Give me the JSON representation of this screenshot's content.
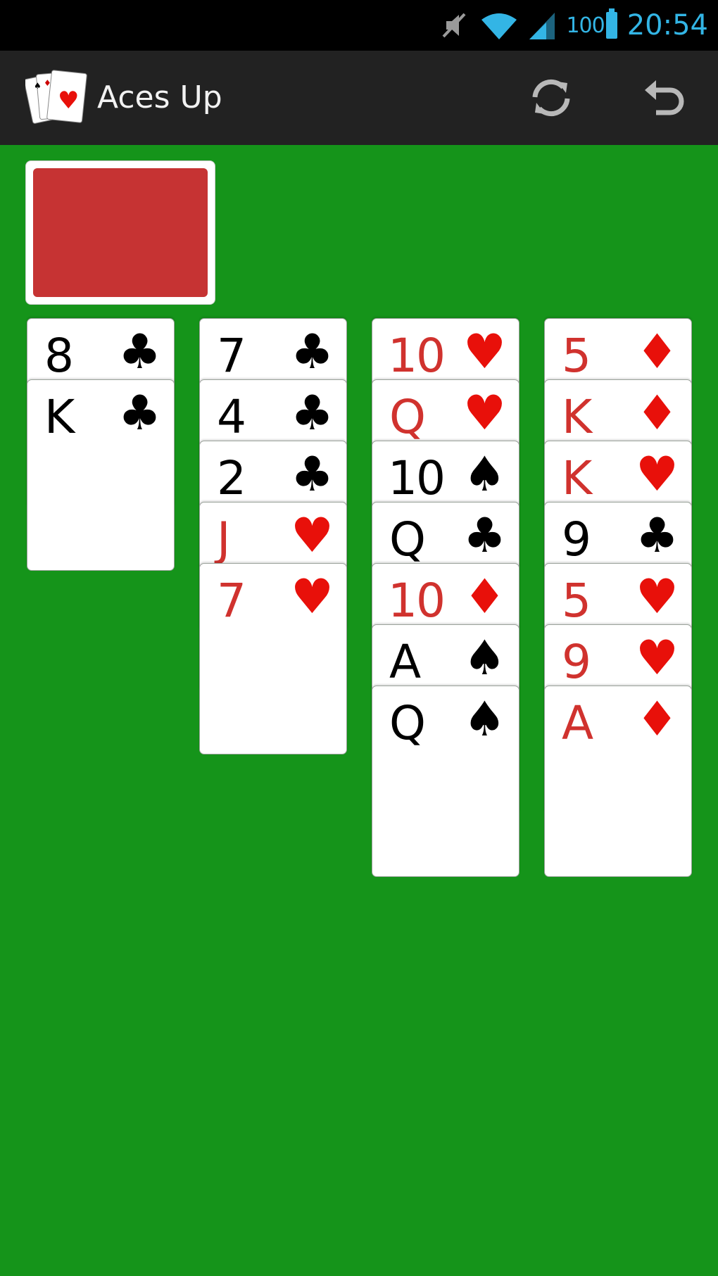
{
  "status_bar": {
    "icons": [
      "mute-icon",
      "wifi-icon",
      "signal-icon"
    ],
    "battery": "100",
    "time": "20:54",
    "color": "#33b5e5"
  },
  "action_bar": {
    "title": "Aces Up",
    "actions": [
      "refresh-icon",
      "undo-icon"
    ]
  },
  "stock": {
    "card_back_color": "#c63333"
  },
  "colors": {
    "felt": "#15941a",
    "red": "#d0322e",
    "black": "#000000"
  },
  "tableau": [
    {
      "cards": [
        {
          "rank": "8",
          "suit": "♣",
          "color": "black"
        },
        {
          "rank": "K",
          "suit": "♣",
          "color": "black"
        }
      ]
    },
    {
      "cards": [
        {
          "rank": "7",
          "suit": "♣",
          "color": "black"
        },
        {
          "rank": "4",
          "suit": "♣",
          "color": "black"
        },
        {
          "rank": "2",
          "suit": "♣",
          "color": "black"
        },
        {
          "rank": "J",
          "suit": "♥",
          "color": "red"
        },
        {
          "rank": "7",
          "suit": "♥",
          "color": "red"
        }
      ]
    },
    {
      "cards": [
        {
          "rank": "10",
          "suit": "♥",
          "color": "red"
        },
        {
          "rank": "Q",
          "suit": "♥",
          "color": "red"
        },
        {
          "rank": "10",
          "suit": "♠",
          "color": "black"
        },
        {
          "rank": "Q",
          "suit": "♣",
          "color": "black"
        },
        {
          "rank": "10",
          "suit": "♦",
          "color": "red"
        },
        {
          "rank": "A",
          "suit": "♠",
          "color": "black"
        },
        {
          "rank": "Q",
          "suit": "♠",
          "color": "black"
        }
      ]
    },
    {
      "cards": [
        {
          "rank": "5",
          "suit": "♦",
          "color": "red"
        },
        {
          "rank": "K",
          "suit": "♦",
          "color": "red"
        },
        {
          "rank": "K",
          "suit": "♥",
          "color": "red"
        },
        {
          "rank": "9",
          "suit": "♣",
          "color": "black"
        },
        {
          "rank": "5",
          "suit": "♥",
          "color": "red"
        },
        {
          "rank": "9",
          "suit": "♥",
          "color": "red"
        },
        {
          "rank": "A",
          "suit": "♦",
          "color": "red"
        }
      ]
    }
  ]
}
